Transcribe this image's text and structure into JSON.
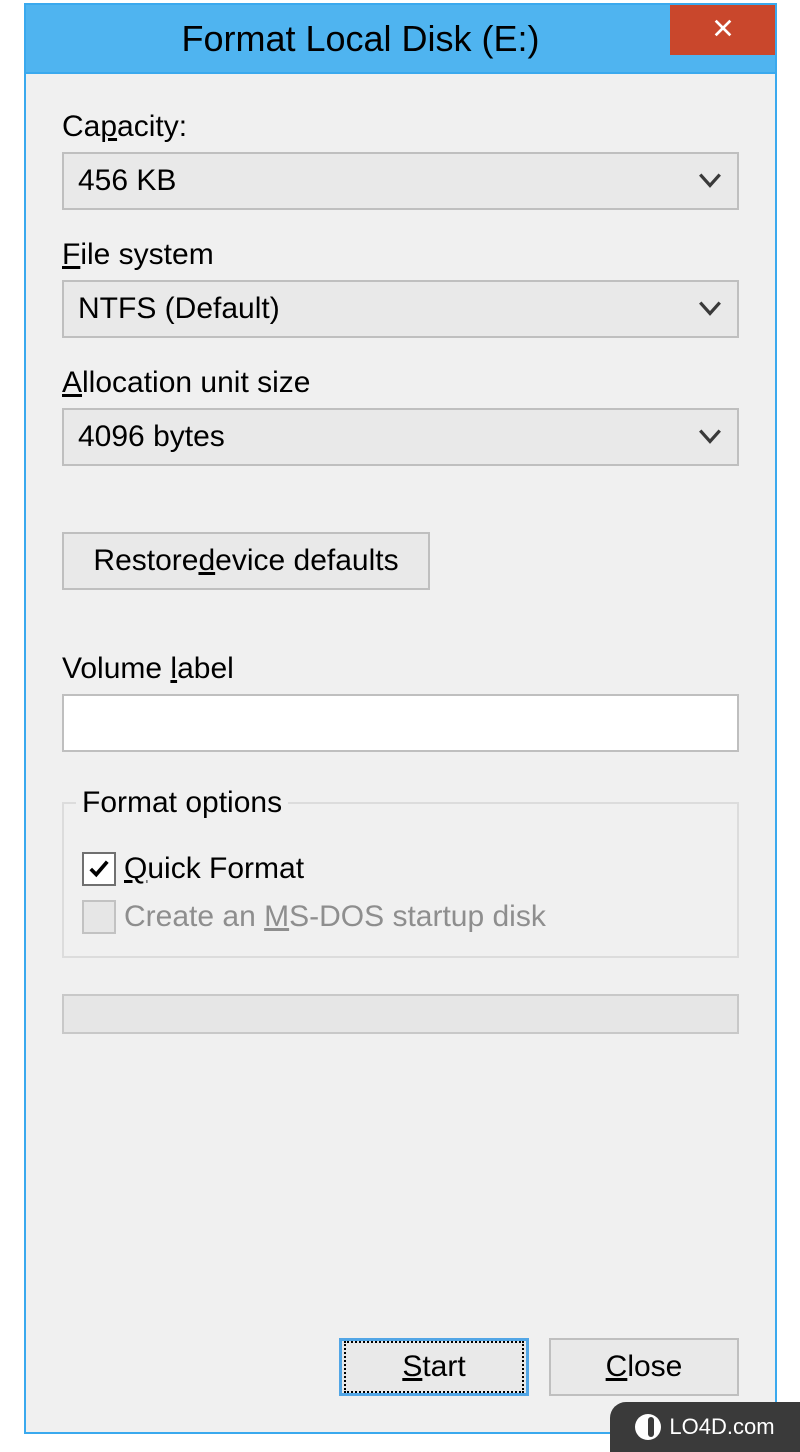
{
  "window": {
    "title": "Format Local Disk (E:)"
  },
  "fields": {
    "capacity": {
      "label_html": "Ca<span class='underline-span'>p</span>acity:",
      "value": "456 KB"
    },
    "file_system": {
      "label_html": "<span class='underline-span'>F</span>ile system",
      "value": "NTFS (Default)"
    },
    "allocation": {
      "label_html": "<span class='underline-span'>A</span>llocation unit size",
      "value": "4096 bytes"
    },
    "restore_btn_html": "Restore <span class='underline-span'>d</span>evice defaults",
    "volume_label": {
      "label_html": "Volume <span class='underline-span'>l</span>abel",
      "value": ""
    }
  },
  "format_options": {
    "legend": "Format options",
    "quick_format": {
      "label_html": "<span class='underline-span'>Q</span>uick Format",
      "checked": true
    },
    "msdos": {
      "label_html": "Create an <span class='underline-span'>M</span>S-DOS startup disk",
      "checked": false,
      "disabled": true
    }
  },
  "buttons": {
    "start_html": "<span class='underline-span'>S</span>tart",
    "close_html": "<span class='underline-span'>C</span>lose"
  },
  "watermark": "LO4D.com"
}
